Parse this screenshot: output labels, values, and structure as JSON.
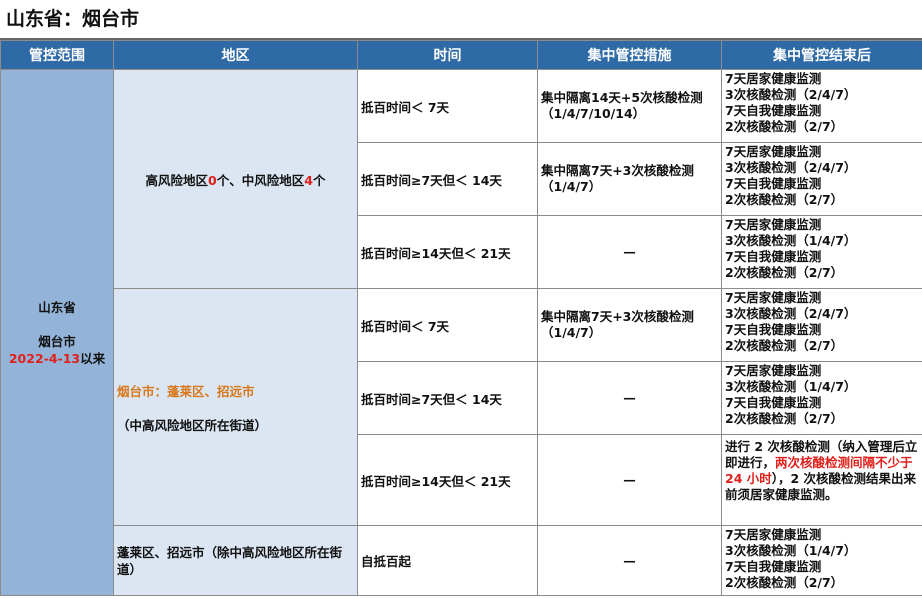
{
  "title": "山东省：烟台市",
  "headers": [
    "管控范围",
    "地区",
    "时间",
    "集中管控措施",
    "集中管控结束后"
  ],
  "scope": {
    "province": "山东省",
    "city": "烟台市",
    "date": "2022-4-13",
    "since": "以来"
  },
  "region1": {
    "p1": "高风险地区",
    "high_count": "0",
    "p2": "个、中风险地区",
    "mid_count": "4",
    "p3": "个"
  },
  "region2": {
    "name": "烟台市：蓬莱区、招远市",
    "note": "（中高风险地区所在街道）"
  },
  "region3": {
    "name": "蓬莱区、招远市（除中高风险地区所在街道）"
  },
  "rows": [
    {
      "time": "抵百时间＜ 7天",
      "measure": [
        "集中隔离14天+5次核酸检测",
        "（1/4/7/10/14）"
      ],
      "after": [
        "7天居家健康监测",
        "3次核酸检测（2/4/7）",
        "7天自我健康监测",
        "2次核酸检测（2/7）"
      ]
    },
    {
      "time": "抵百时间≥7天但＜ 14天",
      "measure": [
        "集中隔离7天+3次核酸检测",
        "（1/4/7）"
      ],
      "after": [
        "7天居家健康监测",
        "3次核酸检测（2/4/7）",
        "7天自我健康监测",
        "2次核酸检测（2/7）"
      ]
    },
    {
      "time": "抵百时间≥14天但＜ 21天",
      "measure": [
        "—"
      ],
      "after": [
        "7天居家健康监测",
        "3次核酸检测（1/4/7）",
        "7天自我健康监测",
        "2次核酸检测（2/7）"
      ]
    },
    {
      "time": "抵百时间＜ 7天",
      "measure": [
        "集中隔离7天+3次核酸检测",
        "（1/4/7）"
      ],
      "after": [
        "7天居家健康监测",
        "3次核酸检测（2/4/7）",
        "7天自我健康监测",
        "2次核酸检测（2/7）"
      ]
    },
    {
      "time": "抵百时间≥7天但＜ 14天",
      "measure": [
        "—"
      ],
      "after": [
        "7天居家健康监测",
        "3次核酸检测（1/4/7）",
        "7天自我健康监测",
        "2次核酸检测（2/7）"
      ]
    },
    {
      "time": "抵百时间≥14天但＜ 21天",
      "measure": [
        "—"
      ],
      "after_rich": {
        "a": "进行 2 次核酸检测（纳入管理后立即进行，",
        "b": "两次核酸检测间隔不少于 24 小时",
        "c": "），2 次核酸检测结果出来前须居家健康监测。"
      }
    },
    {
      "time": "自抵百起",
      "measure": [
        "—"
      ],
      "after": [
        "7天居家健康监测",
        "3次核酸检测（1/4/7）",
        "7天自我健康监测",
        "2次核酸检测（2/7）"
      ]
    }
  ],
  "colors": {
    "header_bg": "#2e6aa6",
    "scope_bg": "#93b4d8",
    "region_bg": "#dbe6f2",
    "highlight_red": "#e0201b",
    "highlight_orange": "#d8781c"
  }
}
